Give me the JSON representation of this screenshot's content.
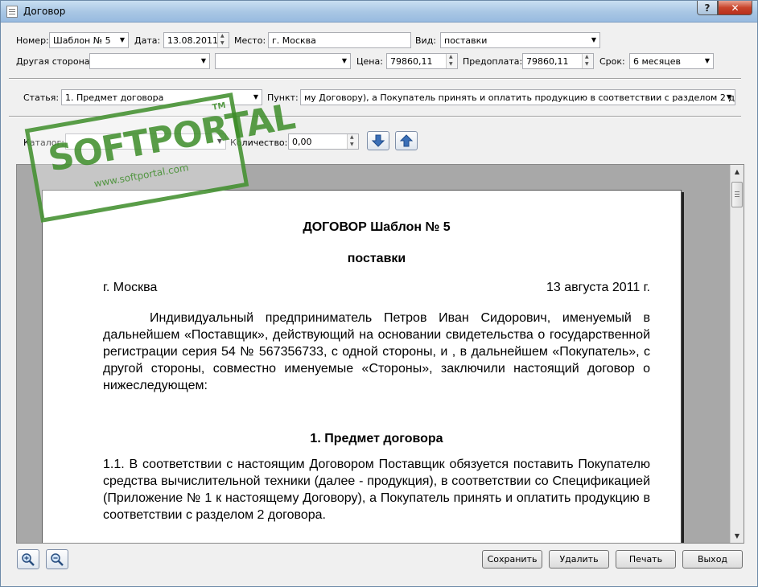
{
  "window": {
    "title": "Договор",
    "help_label": "?",
    "close_label": "✕"
  },
  "row1": {
    "number_label": "Номер:",
    "number_value": "Шаблон № 5",
    "date_label": "Дата:",
    "date_value": "13.08.2011",
    "place_label": "Место:",
    "place_value": "г. Москва",
    "type_label": "Вид:",
    "type_value": "поставки"
  },
  "row2": {
    "party_label": "Другая сторона:",
    "party_value": "",
    "party2_value": "",
    "price_label": "Цена:",
    "price_value": "79860,11",
    "prepay_label": "Предоплата:",
    "prepay_value": "79860,11",
    "term_label": "Срок:",
    "term_value": "6 месяцев"
  },
  "row3": {
    "article_label": "Статья:",
    "article_value": "1. Предмет договора",
    "point_label": "Пункт:",
    "point_value": "му Договору), а Покупатель принять и оплатить продукцию в  соответствии с разделом 2 договора."
  },
  "row4": {
    "catalog_label": "Каталог:",
    "catalog_value": "",
    "qty_label": "Количество:",
    "qty_value": "0,00"
  },
  "document": {
    "title": "ДОГОВОР Шаблон № 5",
    "subtitle": "поставки",
    "city": "г. Москва",
    "date": "13 августа 2011 г.",
    "intro": "Индивидуальный предприниматель Петров Иван Сидорович, именуемый в дальнейшем «Поставщик», действующий на основании свидетельства о государственной регистрации серия 54 № 567356733, с одной стороны, и ,  в дальнейшем «Покупатель», с другой стороны, совместно именуемые «Стороны», заключили настоящий договор о нижеследующем:",
    "section_title": "1. Предмет договора",
    "clause_1_1": "1.1. В соответствии с настоящим Договором Поставщик обязуется поставить Покупателю средства вычислительной техники (далее - продукция), в соответствии со Спецификацией (Приложение № 1 к настоящему Договору), а Покупатель принять и оплатить продукцию в  соответствии с разделом 2 договора."
  },
  "buttons": {
    "save": "Сохранить",
    "delete": "Удалить",
    "print": "Печать",
    "exit": "Выход"
  },
  "watermark": {
    "brand": "SOFTPORTAL",
    "tm": "TM",
    "url": "www.softportal.com"
  },
  "colors": {
    "accent_blue": "#3a6fb7",
    "stamp_green": "#3c8c28"
  }
}
